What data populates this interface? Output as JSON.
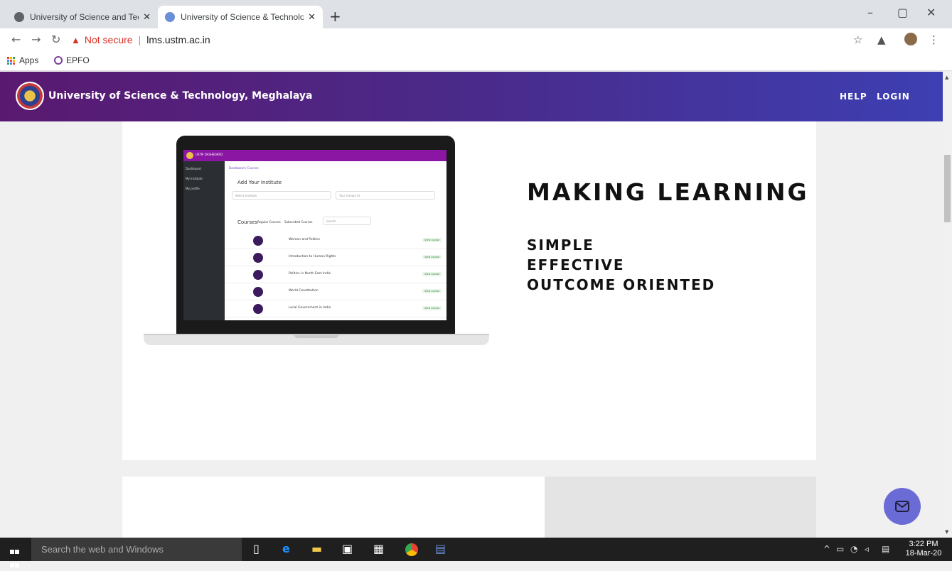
{
  "browser": {
    "tabs": [
      {
        "title": "University of Science and Techno",
        "active": false
      },
      {
        "title": "University of Science & Technolo",
        "active": true
      }
    ],
    "new_tab": "+",
    "omnibox": {
      "security_label": "Not secure",
      "url": "lms.ustm.ac.in"
    },
    "bookmarks": [
      {
        "label": "Apps"
      },
      {
        "label": "EPFO"
      }
    ]
  },
  "site": {
    "brand": "University of Science & Technology, Meghalaya",
    "nav": {
      "help": "HELP",
      "login": "LOGIN"
    }
  },
  "hero": {
    "heading": "MAKING LEARNING",
    "lines": [
      "SIMPLE",
      "EFFECTIVE",
      "OUTCOME ORIENTED"
    ]
  },
  "mockup": {
    "topbar_title": "USTM DASHBOARD",
    "sidebar": [
      "Dashboard",
      "My Institute",
      "My profile"
    ],
    "breadcrumb": "Dashboard / Courses",
    "add_institute": "Add Your Institute",
    "select_placeholder": "Select Institute",
    "unique_placeholder": "Your Unique Id",
    "courses_label": "Courses",
    "course_filters": [
      "Regular Courses",
      "Subscribed Courses"
    ],
    "search_placeholder": "Search",
    "view_label": "View course",
    "courses": [
      "Women and Politics",
      "Introduction to Human Rights",
      "Politics in North East India",
      "World Constitution",
      "Local Government in India"
    ]
  },
  "taskbar": {
    "search_placeholder": "Search the web and Windows",
    "time": "3:22 PM",
    "date": "18-Mar-20"
  },
  "colors": {
    "header_start": "#5a1970",
    "header_end": "#3d3fb3",
    "fab": "#6b6bd6",
    "mockup_topbar": "#8a16a3"
  }
}
